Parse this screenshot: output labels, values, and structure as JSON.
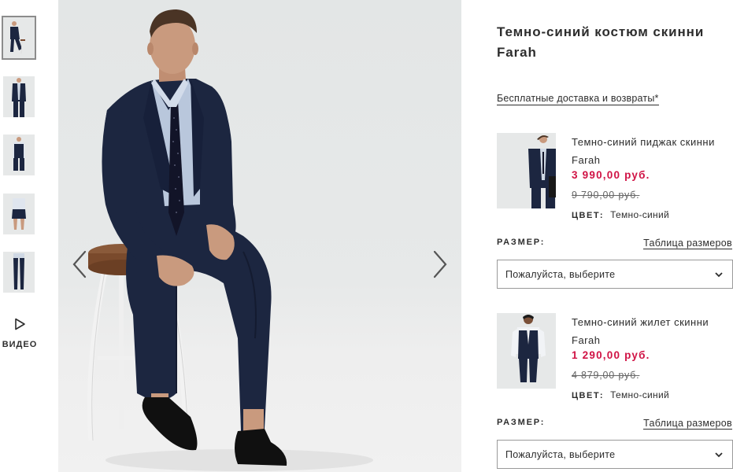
{
  "gallery": {
    "thumbnails": [
      {
        "label": "thumb-1",
        "active": true
      },
      {
        "label": "thumb-2",
        "active": false
      },
      {
        "label": "thumb-3",
        "active": false
      },
      {
        "label": "thumb-4",
        "active": false
      },
      {
        "label": "thumb-5",
        "active": false
      }
    ],
    "video_label": "ВИДЕО",
    "video_icon": "play-icon",
    "prev_icon": "chevron-left-icon",
    "next_icon": "chevron-right-icon"
  },
  "product": {
    "title": "Темно-синий костюм скинни Farah",
    "delivery_link": "Бесплатные доставка и возвраты*"
  },
  "items": [
    {
      "name": "Темно-синий пиджак скинни Farah",
      "price": "3 990,00 руб.",
      "old_price": "9 790,00 руб.",
      "color_label": "ЦВЕТ:",
      "color_value": "Темно-синий",
      "size_label": "РАЗМЕР:",
      "size_guide": "Таблица размеров",
      "select_value": "Пожалуйста, выберите"
    },
    {
      "name": "Темно-синий жилет скинни Farah",
      "price": "1 290,00 руб.",
      "old_price": "4 879,00 руб.",
      "color_label": "ЦВЕТ:",
      "color_value": "Темно-синий",
      "size_label": "РАЗМЕР:",
      "size_guide": "Таблица размеров",
      "select_value": "Пожалуйста, выберите"
    }
  ],
  "colors": {
    "price": "#d01345",
    "text": "#2d2d2d",
    "suit": "#1c2640"
  }
}
